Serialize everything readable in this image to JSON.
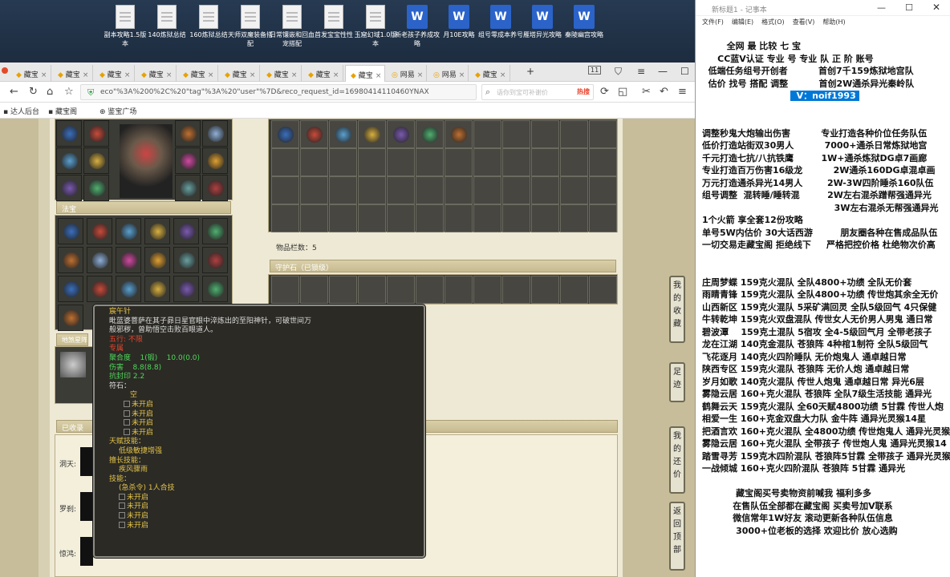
{
  "desktop": {
    "icons": [
      {
        "label": "副本攻略1.5版本",
        "type": "doc"
      },
      {
        "label": "140炼狱总结",
        "type": "doc"
      },
      {
        "label": "160炼狱总结",
        "type": "doc"
      },
      {
        "label": "天师双魔装备搭配",
        "type": "doc"
      },
      {
        "label": "日常镶嵌和回血宠搭配",
        "type": "doc"
      },
      {
        "label": "首发宝宝性性",
        "type": "doc"
      },
      {
        "label": "玉窟幻域1.0版本",
        "type": "doc"
      },
      {
        "label": "新老孩子养成攻略",
        "type": "word"
      },
      {
        "label": "月10E攻略",
        "type": "word"
      },
      {
        "label": "组号零成本养号",
        "type": "word"
      },
      {
        "label": "雁塔异光攻略",
        "type": "word"
      },
      {
        "label": "秦陵幽宫攻略",
        "type": "word"
      }
    ]
  },
  "browser": {
    "tabs": [
      "藏宝",
      "藏宝",
      "藏宝",
      "藏宝",
      "藏宝",
      "藏宝",
      "藏宝",
      "藏宝",
      "藏宝",
      "网易",
      "网易",
      "藏宝"
    ],
    "tab_count": "11",
    "url": "eco\"%3A%200%2C%20\"tag\"%3A%20\"user\"%7D&reco_request_id=16980414110460YNAX",
    "search_placeholder": "语你到宝可补谢价",
    "hot_label": "热搜",
    "bookmarks": [
      "达人后台",
      "藏宝阁",
      "鉴宝广场"
    ]
  },
  "game": {
    "section_fabao": "法宝",
    "section_xianling": "地煞星阵",
    "item_count_label": "物品栏数：",
    "item_count": "5",
    "guard_stone_label": "守护石（已锁级）",
    "collected_label": "已收录",
    "pet_labels": [
      "洞天:",
      "罗刹:",
      "惊鸿:"
    ],
    "side_buttons": [
      "我的收藏",
      "足迹",
      "我的还价",
      "返回顶部"
    ]
  },
  "tooltip": {
    "name": "宸午针",
    "desc1": "毗蓝婆菩萨在其子昴日星官眼中淬炼出的至阳神针，可破世间万",
    "desc2": "般邪秽，曾助悟空击败百眼道人。",
    "bind": "五行: 不限",
    "owner": "专属",
    "stat1_label": "聚合度",
    "stat1_val": "1(锻)",
    "stat1_extra": "10.0(0.0)",
    "stat2_label": "伤害",
    "stat2_val": "8.8(8.8)",
    "stat3": "抗封印 2.2",
    "fushi_label": "符石：",
    "empty": "空",
    "unopened": "未开启",
    "talent_label": "天赋技能：",
    "talent": "低级敏捷增强",
    "special_label": "擅长技能：",
    "special": "疾风骤雨",
    "skill_label": "技能：",
    "skill": "(急杀令) 1人合技"
  },
  "notepad": {
    "title": "新标题1 - 记事本",
    "menu": [
      "文件(F)",
      "编辑(E)",
      "格式(O)",
      "查看(V)",
      "帮助(H)"
    ],
    "lines": [
      "        全网 最 比较 七 宝 ",
      "     CC蓝V认证 专业 号 专业 队 正 阶 账号",
      "  低端任务组号开创者          首创7千159炼狱地宫队",
      "  估价 找号 搭配 调整          首创2W通杀异光秦岭队",
      "",
      "",
      "调整秒鬼大炮输出伤害          专业打造各种价位任务队伍",
      "低价打造站街双30男人          7000+通杀日常炼狱地宫",
      "千元打造七抗/八抗铁鹰         1W+通杀炼狱DG卓7画廊",
      "专业打造百万伤害16级龙          2W通杀160DG卓混卓画",
      "万元打造通杀异光14男人        2W-3W四阶睡杀160队伍",
      "组号调整  混转睡/睡转混         2W左右混杀蹭帮强通异光",
      "                                           3W左右混杀无帮强通异光",
      "1个火箭 享全套12份攻略",
      "单号5W内估价 30大话西游         朋友圈各种在售成品队伍",
      "一切交易走藏宝阁 拒绝线下     严格把控价格 杜绝物次价高",
      "",
      "",
      "庄周梦蝶 159克火混队 全队4800+功绩 全队无价套",
      "雨睛青锋 159克火混队 全队4800+功绩 传世炮其余全无价",
      "山西新区 159克火混队 5采矿满回灵 全队5级回气 4只保健",
      "牛转乾坤 159克火双盘混队 传世女人无价男人男鬼 通日常",
      "碧波潭    159克土混队 5宿攻 全4-5级回气月 全带老孩子",
      "龙在江湖 140克金混队 苍狼阵 4种棺1制符 全队5级回气",
      "飞花逐月 140克火四阶睡队 无价炮鬼人 通卓越日常",
      "陕西专区 159克火混队 苍狼阵 无价人炮 通卓越日常",
      "岁月如歌 140克火混队 传世人炮鬼 通卓越日常 异光6层",
      "雾隐云居 160+克火混队 苍狼阵 全队7级生活技能 通异光",
      "鹤舞云天 159克火混队 全60天赋4800功绩 5甘霖 传世人炮",
      "相爱一生 160+克金双盘大力队 金牛阵 通异光灵猴14星",
      "把酒言欢 160+克火混队 全4800功绩 传世炮鬼人 通异光灵猴",
      "雾隐云居 160+克火混队 全带孩子 传世炮人鬼 通异光灵猴14",
      "踏雪寻芳 159克木四阶混队 苍狼阵5甘霖 全带孩子 通异光灵猴",
      "一战倾城 160+克火四阶混队 苍狼阵 5甘霖 通异光",
      "",
      "           藏宝阁买号卖物资前喊我 福利多多",
      "          在售队伍全部都在藏宝阁 买卖号加V联系",
      "          微信常年1W好友 滚动更新各种队伍信息",
      "           3000+位老板的选择 欢迎比价 放心选购"
    ],
    "selected_line": "V：noif1993"
  },
  "colors": {
    "accent": "#0078d7",
    "game_bg": "#eee9d4",
    "tooltip_bg": "#2b2a25"
  }
}
